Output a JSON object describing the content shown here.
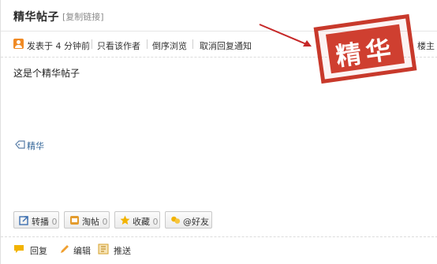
{
  "header": {
    "title": "精华帖子",
    "copy_link": "[复制链接]"
  },
  "meta": {
    "posted": "发表于 4 分钟前",
    "author_only": "只看该作者",
    "reverse": "倒序浏览",
    "cancel_notify": "取消回复通知",
    "floor": "楼主"
  },
  "post": {
    "content": "这是个精华帖子",
    "tag": "精华"
  },
  "stamp": {
    "text": "精华",
    "color": "#c8392b"
  },
  "actions": [
    {
      "icon": "share-icon",
      "label": "转播",
      "count": "0"
    },
    {
      "icon": "tao-icon",
      "label": "淘帖",
      "count": "0"
    },
    {
      "icon": "star-icon",
      "label": "收藏",
      "count": "0"
    },
    {
      "icon": "at-friends-icon",
      "label": "@好友",
      "count": ""
    }
  ],
  "bottom": {
    "reply": "回复",
    "edit": "编辑",
    "push": "推送"
  }
}
